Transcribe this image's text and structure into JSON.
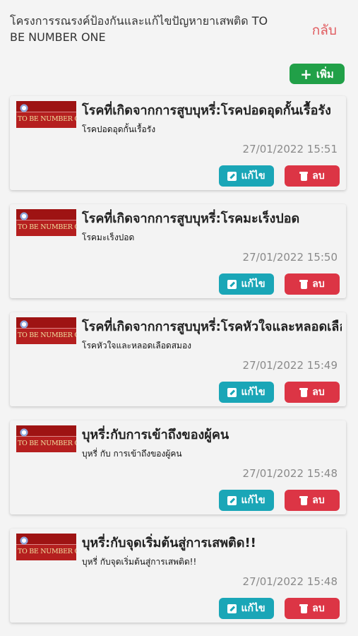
{
  "header": {
    "title": "โครงการรณรงค์ป้องกันและแก้ไขปัญหายาเสพติด TO BE NUMBER ONE",
    "back_label": "กลับ"
  },
  "toolbar": {
    "add_label": "เพิ่ม"
  },
  "thumbnail": {
    "caption": "TO BE NUMBER ONE"
  },
  "actions": {
    "edit_label": "แก้ไข",
    "delete_label": "ลบ"
  },
  "colors": {
    "add_button": "#21a048",
    "edit_button": "#1aa6b7",
    "delete_button": "#dc3545",
    "back_link": "#e05a5e"
  },
  "items": [
    {
      "title": "โรคที่เกิดจากการสูบบุหรี่:โรคปอดอุดกั้นเรื้อรัง",
      "subtitle": "โรคปอดอุดกั้นเรื้อรัง",
      "timestamp": "27/01/2022 15:51"
    },
    {
      "title": "โรคที่เกิดจากการสูบบุหรี่:โรคมะเร็งปอด",
      "subtitle": "โรคมะเร็งปอด",
      "timestamp": "27/01/2022 15:50"
    },
    {
      "title": "โรคที่เกิดจากการสูบบุหรี่:โรคหัวใจและหลอดเลือด",
      "subtitle": "โรคหัวใจและหลอดเลือดสมอง",
      "timestamp": "27/01/2022 15:49"
    },
    {
      "title": "บุหรี่:กับการเข้าถึงของผู้คน",
      "subtitle": "บุหรี่ กับ การเข้าถึงของผู้คน",
      "timestamp": "27/01/2022 15:48"
    },
    {
      "title": "บุหรี่:กับจุดเริ่มต้นสู่การเสพติด!!",
      "subtitle": "บุหรี่ กับจุดเริ่มต้นสู่การเสพติด!!",
      "timestamp": "27/01/2022 15:48"
    }
  ]
}
